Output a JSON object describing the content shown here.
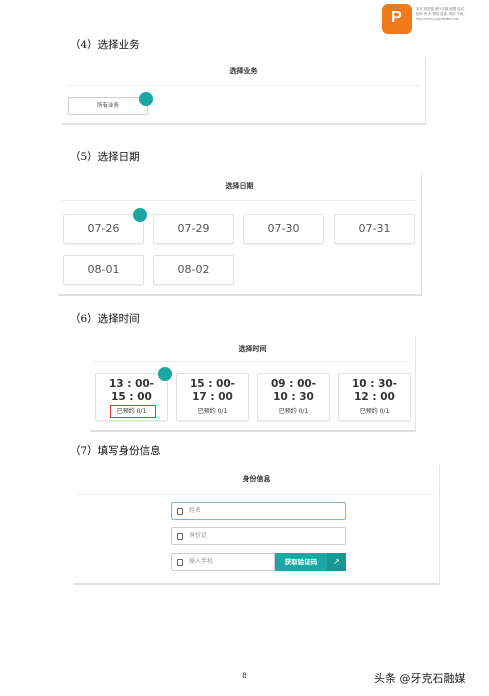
{
  "watermark": {
    "logo": "P",
    "lines": [
      "本文 档是整 册PDF格 威图 自成,",
      "如你 有 大 侵权 或误..清的 下段;",
      "http://www.p.cupdfeditor.com"
    ]
  },
  "sections": {
    "s4": "（4）选择业务",
    "s5": "（5）选择日期",
    "s6": "（6）选择时间",
    "s7": "（7）填写身份信息"
  },
  "business_panel": {
    "title": "选择业务",
    "select_value": "所有业务"
  },
  "date_panel": {
    "title": "选择日期",
    "dates": [
      "07-26",
      "07-29",
      "07-30",
      "07-31",
      "08-01",
      "08-02"
    ]
  },
  "time_panel": {
    "title": "选择时间",
    "slots": [
      {
        "line1": "13 : 00-",
        "line2": "15 : 00",
        "status": "已预约 0/1"
      },
      {
        "line1": "15 : 00-",
        "line2": "17 : 00",
        "status": "已预约 0/1"
      },
      {
        "line1": "09 : 00-",
        "line2": "10 : 30",
        "status": "已预约 0/1"
      },
      {
        "line1": "10 : 30-",
        "line2": "12 : 00",
        "status": "已预约 0/1"
      }
    ]
  },
  "identity_panel": {
    "title": "身份信息",
    "name_placeholder": "姓名",
    "id_placeholder": "身份证",
    "phone_placeholder": "输入手机",
    "code_button": "获取验证码",
    "ext_icon": "↗"
  },
  "footer": {
    "page_number": "8",
    "credit": "头条 @牙克石融媒"
  },
  "colors": {
    "accent": "#1ba7a3",
    "highlight": "#e53935",
    "logo": "#f07a1a"
  }
}
